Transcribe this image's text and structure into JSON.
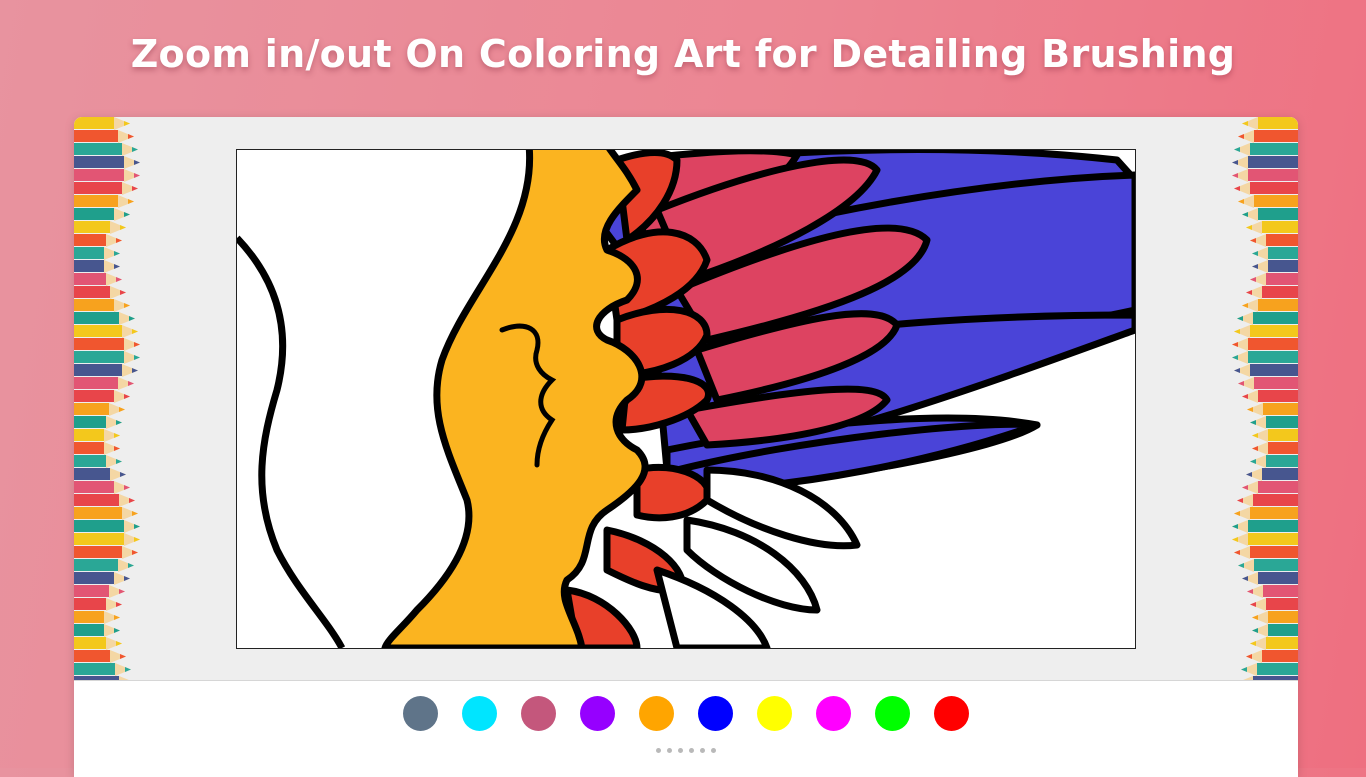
{
  "headline": "Zoom in/out On Coloring Art for Detailing Brushing",
  "palette": {
    "colors": [
      {
        "name": "slate",
        "hex": "#5f7489"
      },
      {
        "name": "cyan",
        "hex": "#00e5ff"
      },
      {
        "name": "rose",
        "hex": "#c4577c"
      },
      {
        "name": "violet",
        "hex": "#9600ff"
      },
      {
        "name": "orange",
        "hex": "#ffa500"
      },
      {
        "name": "blue",
        "hex": "#0000ff"
      },
      {
        "name": "yellow",
        "hex": "#ffff00"
      },
      {
        "name": "magenta",
        "hex": "#ff00ff"
      },
      {
        "name": "green",
        "hex": "#00ff00"
      },
      {
        "name": "red",
        "hex": "#ff0000"
      }
    ]
  },
  "pager": {
    "page_count": 6
  },
  "artwork": {
    "subject": "zoomed bird wing",
    "fill_colors": {
      "body": "#fbb420",
      "feather_red": "#e8402a",
      "feather_pink": "#dd4361",
      "feather_blue": "#4a44d8"
    }
  },
  "decor": {
    "pencil_colors": [
      "#f3c81c",
      "#f0562f",
      "#2aa796",
      "#47568f",
      "#e25574",
      "#e8454a",
      "#f7a21e",
      "#1f9f8c"
    ]
  }
}
